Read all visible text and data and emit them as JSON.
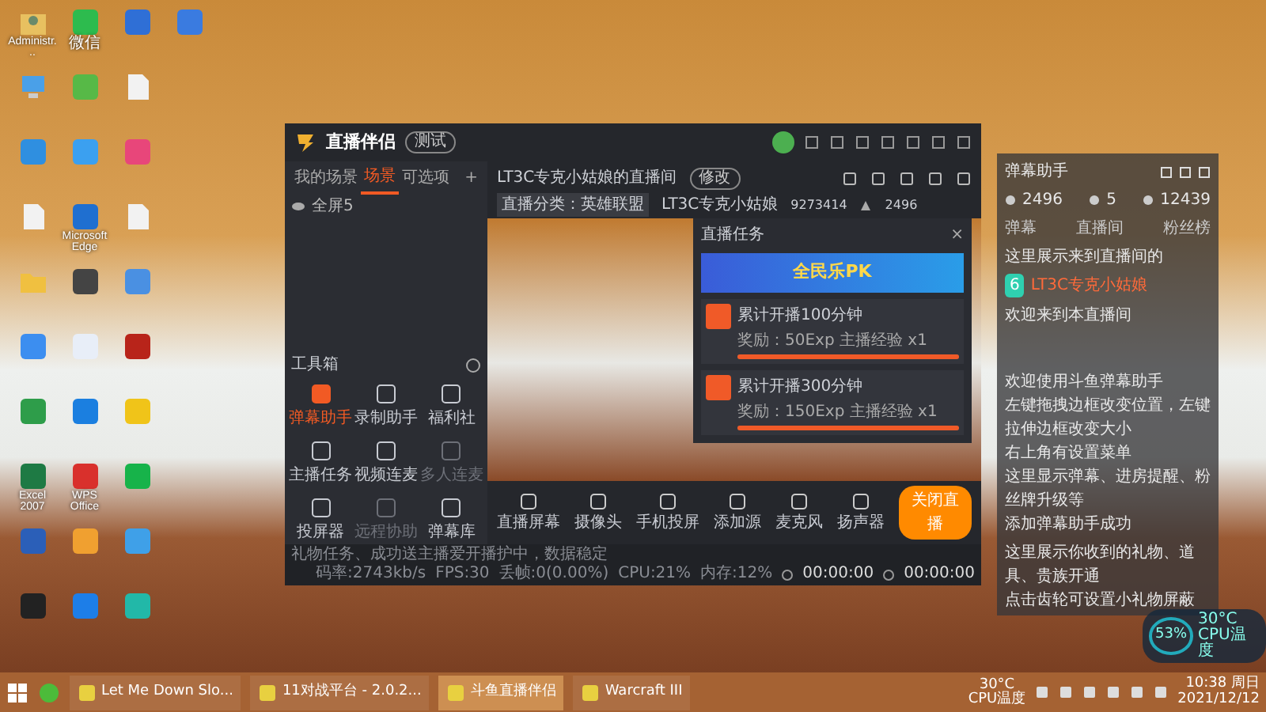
{
  "desktop_rows": [
    [
      {
        "kind": "user",
        "label": "Administr..."
      },
      {
        "kind": "app",
        "color": "#2dbb4e",
        "label": "微信"
      },
      {
        "kind": "app",
        "color": "#2f6fd6"
      },
      {
        "kind": "app",
        "color": "#3a7be0"
      }
    ],
    [
      {
        "kind": "computer"
      },
      {
        "kind": "app",
        "color": "#57b947"
      },
      {
        "kind": "file"
      }
    ],
    [
      {
        "kind": "app",
        "color": "#2f8fe0"
      },
      {
        "kind": "app",
        "color": "#3ba0f0"
      },
      {
        "kind": "app",
        "color": "#e8467a"
      }
    ],
    [
      {
        "kind": "file"
      },
      {
        "kind": "app",
        "color": "#1f6fd0",
        "label": "Microsoft Edge"
      },
      {
        "kind": "file"
      }
    ],
    [
      {
        "kind": "folder"
      },
      {
        "kind": "app",
        "color": "#444444"
      },
      {
        "kind": "app",
        "color": "#4a90e2"
      }
    ],
    [
      {
        "kind": "app",
        "color": "#3c8ef0"
      },
      {
        "kind": "app",
        "color": "#e8eef8"
      },
      {
        "kind": "app",
        "color": "#b8241a"
      }
    ],
    [
      {
        "kind": "app",
        "color": "#2e9d4a"
      },
      {
        "kind": "app",
        "color": "#1b7fe0"
      },
      {
        "kind": "app",
        "color": "#f0c419"
      }
    ],
    [
      {
        "kind": "app",
        "color": "#1e7a44",
        "label": "Excel 2007"
      },
      {
        "kind": "app",
        "color": "#d9302c",
        "label": "WPS Office"
      },
      {
        "kind": "app",
        "color": "#17b34a"
      }
    ],
    [
      {
        "kind": "app",
        "color": "#2b5fb8"
      },
      {
        "kind": "app",
        "color": "#f0a030"
      },
      {
        "kind": "app",
        "color": "#3fa0e8"
      }
    ],
    [
      {
        "kind": "app",
        "color": "#222222"
      },
      {
        "kind": "app",
        "color": "#1d7ee8"
      },
      {
        "kind": "app",
        "color": "#22b8a8"
      }
    ]
  ],
  "app": {
    "name": "直播伴侣",
    "badge": "测试",
    "scene_tabs": [
      {
        "label": "我的场景",
        "selected": false
      },
      {
        "label": "场景",
        "selected": true
      },
      {
        "label": "可选项",
        "selected": false
      }
    ],
    "add_symbol": "+",
    "source_item": "全屏5",
    "toolbox_title": "工具箱",
    "tools": [
      {
        "label": "弹幕助手",
        "active": true,
        "disabled": false
      },
      {
        "label": "录制助手",
        "active": false,
        "disabled": false
      },
      {
        "label": "福利社",
        "active": false,
        "disabled": false
      },
      {
        "label": "主播任务",
        "active": false,
        "disabled": false
      },
      {
        "label": "视频连麦",
        "active": false,
        "disabled": false
      },
      {
        "label": "多人连麦",
        "active": false,
        "disabled": true
      },
      {
        "label": "投屏器",
        "active": false,
        "disabled": false
      },
      {
        "label": "远程协助",
        "active": false,
        "disabled": true
      },
      {
        "label": "弹幕库",
        "active": false,
        "disabled": false
      }
    ],
    "room_title": "LT3C专克小姑娘的直播间",
    "edit_tag": "修改",
    "category": "直播分类：英雄联盟",
    "streamer": "LT3C专克小姑娘",
    "room_id": "9273414",
    "fans": "2496",
    "tasks_popup": {
      "title": "直播任务",
      "close": "×",
      "banner": "全民乐PK",
      "tasks": [
        {
          "name": "累计开播100分钟",
          "reward": "奖励：50Exp 主播经验 x1",
          "level": 1
        },
        {
          "name": "累计开播300分钟",
          "reward": "奖励：150Exp 主播经验 x1",
          "level": 1
        }
      ]
    },
    "controls": [
      "直播屏幕",
      "摄像头",
      "手机投屏",
      "添加源",
      "麦克风",
      "扬声器"
    ],
    "stop_button": "关闭直播",
    "notice": "礼物任务、成功送主播爱开播护中，数据稳定",
    "stats": [
      "码率:2743kb/s",
      "FPS:30",
      "丢帧:0(0.00%)",
      "CPU:21%",
      "内存:12%"
    ],
    "timers": [
      "00:00:00",
      "00:00:00"
    ]
  },
  "danmu_panel": {
    "title": "弹幕助手",
    "counts": [
      "2496",
      "5",
      "12439"
    ],
    "tabs": [
      {
        "label": "弹幕",
        "selected": false
      },
      {
        "label": "直播间",
        "selected": false
      },
      {
        "label": "粉丝榜",
        "selected": false
      }
    ],
    "system_line": "这里展示来到直播间的",
    "user_line": {
      "level": "6",
      "name": "LT3C专克小姑娘",
      "text": "欢迎来到本直播间"
    },
    "help": [
      "欢迎使用斗鱼弹幕助手",
      "左键拖拽边框改变位置，左键拉伸边框改变大小",
      "右上角有设置菜单",
      "这里显示弹幕、进房提醒、粉丝牌升级等",
      "添加弹幕助手成功"
    ],
    "gift_help": [
      "这里展示你收到的礼物、道具、贵族开通",
      "点击齿轮可设置小礼物屏蔽"
    ]
  },
  "cpu_widget": {
    "usage": "53%",
    "temp": "30°C",
    "label": "CPU温度"
  },
  "taskbar": {
    "items": [
      {
        "label": "Let Me Down Slo...",
        "active": false
      },
      {
        "label": "11对战平台 - 2.0.2...",
        "active": false
      },
      {
        "label": "斗鱼直播伴侣",
        "active": true
      },
      {
        "label": "Warcraft III",
        "active": false
      }
    ],
    "temp": "30°C",
    "temp_label": "CPU温度",
    "time": "10:38 周日",
    "date": "2021/12/12"
  }
}
